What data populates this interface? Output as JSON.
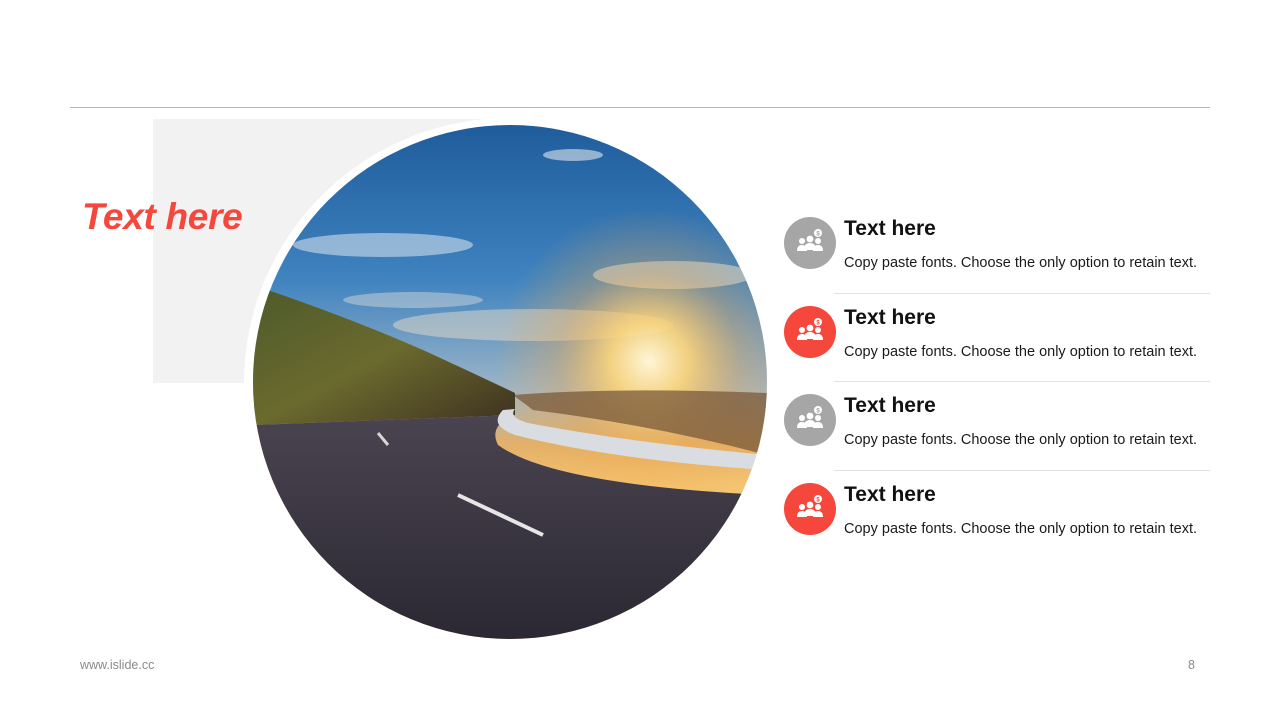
{
  "slide": {
    "title": "Text here",
    "accent_color": "#f5473c",
    "neutral_color": "#a6a6a6"
  },
  "photo": {
    "subject": "winding road at sunset"
  },
  "items": [
    {
      "heading": "Text here",
      "text": "Copy paste fonts. Choose the only option to retain text.",
      "icon": "team-money-icon",
      "icon_color": "#a6a6a6"
    },
    {
      "heading": "Text here",
      "text": "Copy paste fonts. Choose the only option to retain text.",
      "icon": "team-money-icon",
      "icon_color": "#f5473c"
    },
    {
      "heading": "Text here",
      "text": "Copy paste fonts. Choose the only option to retain text.",
      "icon": "team-money-icon",
      "icon_color": "#a6a6a6"
    },
    {
      "heading": "Text here",
      "text": "Copy paste fonts. Choose the only option to retain text.",
      "icon": "team-money-icon",
      "icon_color": "#f5473c"
    }
  ],
  "footer": {
    "url": "www.islide.cc",
    "page_number": "8"
  }
}
